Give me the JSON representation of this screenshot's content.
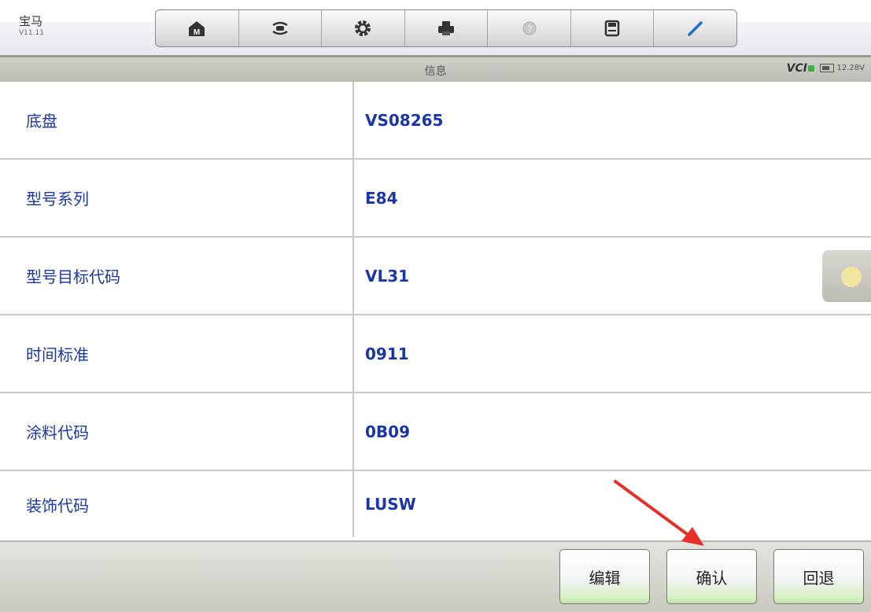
{
  "app": {
    "name": "宝马",
    "version": "V11.11"
  },
  "toolbar": {
    "buttons": [
      {
        "icon": "home-icon"
      },
      {
        "icon": "vehicle-swap-icon"
      },
      {
        "icon": "gear-icon"
      },
      {
        "icon": "printer-icon"
      },
      {
        "icon": "help-icon"
      },
      {
        "icon": "save-icon"
      },
      {
        "icon": "pen-icon"
      }
    ]
  },
  "header": {
    "title": "信息",
    "vci_label": "VCI",
    "voltage": "12.28V"
  },
  "rows": [
    {
      "label": "底盘",
      "value": "VS08265"
    },
    {
      "label": "型号系列",
      "value": "E84"
    },
    {
      "label": "型号目标代码",
      "value": "VL31"
    },
    {
      "label": "时间标准",
      "value": "0911"
    },
    {
      "label": "涂料代码",
      "value": "0B09"
    },
    {
      "label": "装饰代码",
      "value": "LUSW"
    }
  ],
  "actions": {
    "edit": "编辑",
    "confirm": "确认",
    "back": "回退"
  },
  "colors": {
    "accent_text": "#1a36a8",
    "arrow": "#e8302a",
    "button_tint": "#bfe3a9"
  }
}
